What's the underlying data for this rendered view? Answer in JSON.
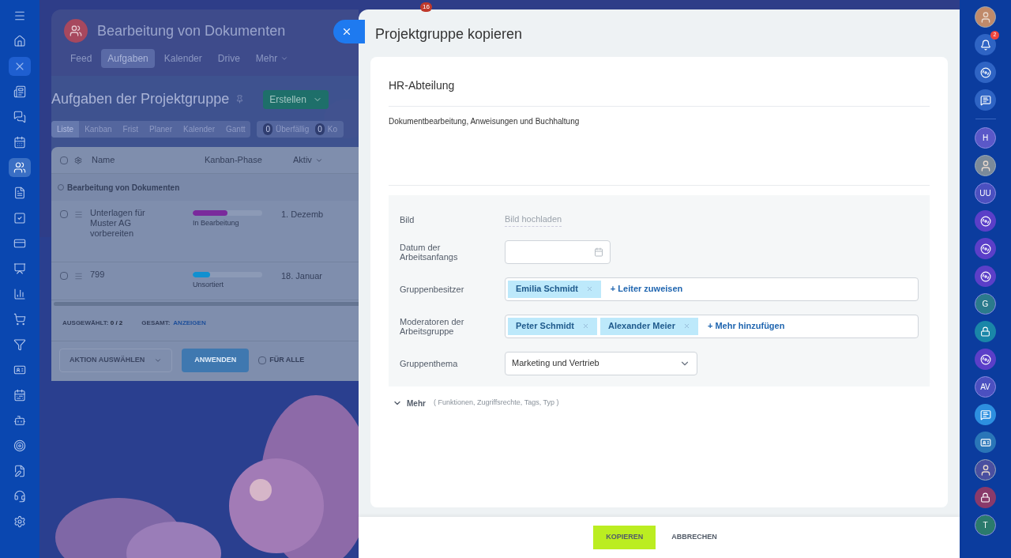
{
  "left_nav": [
    {
      "kind": "menu",
      "selected": false
    },
    {
      "kind": "home",
      "selected": false
    },
    {
      "kind": "close",
      "selected": false
    },
    {
      "kind": "news",
      "selected": false
    },
    {
      "kind": "chats",
      "selected": false
    },
    {
      "kind": "calendar",
      "selected": false
    },
    {
      "kind": "groups",
      "selected": true
    },
    {
      "kind": "document",
      "selected": false
    },
    {
      "kind": "tasks",
      "selected": false
    },
    {
      "kind": "card",
      "selected": false
    },
    {
      "kind": "board",
      "selected": false
    },
    {
      "kind": "chart",
      "selected": false
    },
    {
      "kind": "cart",
      "selected": false
    },
    {
      "kind": "funnel",
      "selected": false
    },
    {
      "kind": "contact",
      "selected": false
    },
    {
      "kind": "schedule",
      "selected": false
    },
    {
      "kind": "robot",
      "selected": false
    },
    {
      "kind": "target",
      "selected": false
    },
    {
      "kind": "sign",
      "selected": false
    },
    {
      "kind": "support",
      "selected": false
    },
    {
      "kind": "settings",
      "selected": false
    }
  ],
  "top_badge": "16",
  "background_app": {
    "title": "Bearbeitung von Dokumenten",
    "tabs": [
      {
        "label": "Feed",
        "selected": false
      },
      {
        "label": "Aufgaben",
        "selected": true
      },
      {
        "label": "Kalender",
        "selected": false
      },
      {
        "label": "Drive",
        "selected": false
      },
      {
        "label": "Mehr",
        "selected": false
      }
    ],
    "heading": "Aufgaben der Projektgruppe",
    "create_button": "Erstellen",
    "views": [
      {
        "label": "Liste",
        "selected": true
      },
      {
        "label": "Kanban",
        "selected": false
      },
      {
        "label": "Frist",
        "selected": false
      },
      {
        "label": "Planer",
        "selected": false
      },
      {
        "label": "Kalender",
        "selected": false
      },
      {
        "label": "Gantt",
        "selected": false
      }
    ],
    "counters": [
      {
        "count": "0",
        "label": "Überfällig"
      },
      {
        "count": "0",
        "label": "Ko"
      }
    ],
    "table": {
      "all_checked": false,
      "columns": [
        "Name",
        "Kanban-Phase",
        "Aktiv"
      ],
      "group": "Bearbeitung von Dokumenten",
      "rows": [
        {
          "name": "Unterlagen für Muster AG vorbereiten",
          "checked": false,
          "level": 0.5,
          "color": "#7a2a9c",
          "phase": "In Bearbeitung",
          "date": "1. Dezemb"
        },
        {
          "name": "799",
          "checked": false,
          "level": 0.25,
          "color": "#1190d0",
          "phase": "Unsortiert",
          "date": "18. Januar"
        }
      ]
    },
    "footer": {
      "selected_label": "AUSGEWÄHLT:",
      "selected_value": "0 / 2",
      "total_label": "GESAMT:",
      "total_link": "ANZEIGEN",
      "action": "AKTION AUSWÄHLEN",
      "apply": "ANWENDEN",
      "for_all": "FÜR ALLE",
      "for_all_checked": false
    }
  },
  "slider": {
    "title": "Projektgruppe kopieren",
    "name": "HR-Abteilung",
    "description": "Dokumentbearbeitung, Anweisungen und Buchhaltung",
    "fields": [
      {
        "kind": "upload",
        "label": "Bild",
        "value": "Bild hochladen"
      },
      {
        "kind": "date",
        "label": "Datum der Arbeitsanfangs"
      },
      {
        "kind": "people",
        "label": "Gruppenbesitzer",
        "tags": [
          "Emilia Schmidt"
        ],
        "add": "+ Leiter zuweisen"
      },
      {
        "kind": "people",
        "label": "Moderatoren der Arbeitsgruppe",
        "tags": [
          "Peter Schmidt",
          "Alexander Meier"
        ],
        "add": "+ Mehr hinzufügen"
      },
      {
        "kind": "select",
        "label": "Gruppenthema",
        "value": "Marketing und Vertrieb"
      }
    ],
    "more": {
      "label": "Mehr",
      "hint": "( Funktionen, Zugriffsrechte, Tags, Typ )",
      "expanded": false
    },
    "buttons": {
      "primary": "KOPIEREN",
      "secondary": "ABBRECHEN"
    }
  },
  "right_bar": {
    "notification_count": "2",
    "items": [
      {
        "kind": "avatar",
        "color": "#c08a6a"
      },
      {
        "kind": "bell",
        "color": "#2f64c4"
      },
      {
        "kind": "spiral",
        "color": "#2f64c4"
      },
      {
        "kind": "chat",
        "color": "#2f64c4"
      },
      {
        "kind": "divider"
      },
      {
        "kind": "initials",
        "text": "H",
        "color": "#5a58c8"
      },
      {
        "kind": "avatar",
        "color": "#7b8a9a"
      },
      {
        "kind": "initials",
        "text": "UU",
        "color": "#4b50c0"
      },
      {
        "kind": "spiral",
        "color": "#5b3fc8"
      },
      {
        "kind": "spiral",
        "color": "#5b3fc8"
      },
      {
        "kind": "spiral",
        "color": "#5b3fc8"
      },
      {
        "kind": "initials",
        "text": "G",
        "color": "#2b7a8c"
      },
      {
        "kind": "lock",
        "color": "#1a86a8"
      },
      {
        "kind": "spiral",
        "color": "#5b3fc8"
      },
      {
        "kind": "initials",
        "text": "AV",
        "color": "#4b50c0"
      },
      {
        "kind": "chat",
        "color": "#2d8fe0"
      },
      {
        "kind": "contact",
        "color": "#2a76b8"
      },
      {
        "kind": "avatar",
        "color": "#4a4fa0"
      },
      {
        "kind": "lock",
        "color": "#8a3a6a"
      },
      {
        "kind": "initials",
        "text": "T",
        "color": "#2b7a6c"
      }
    ]
  }
}
